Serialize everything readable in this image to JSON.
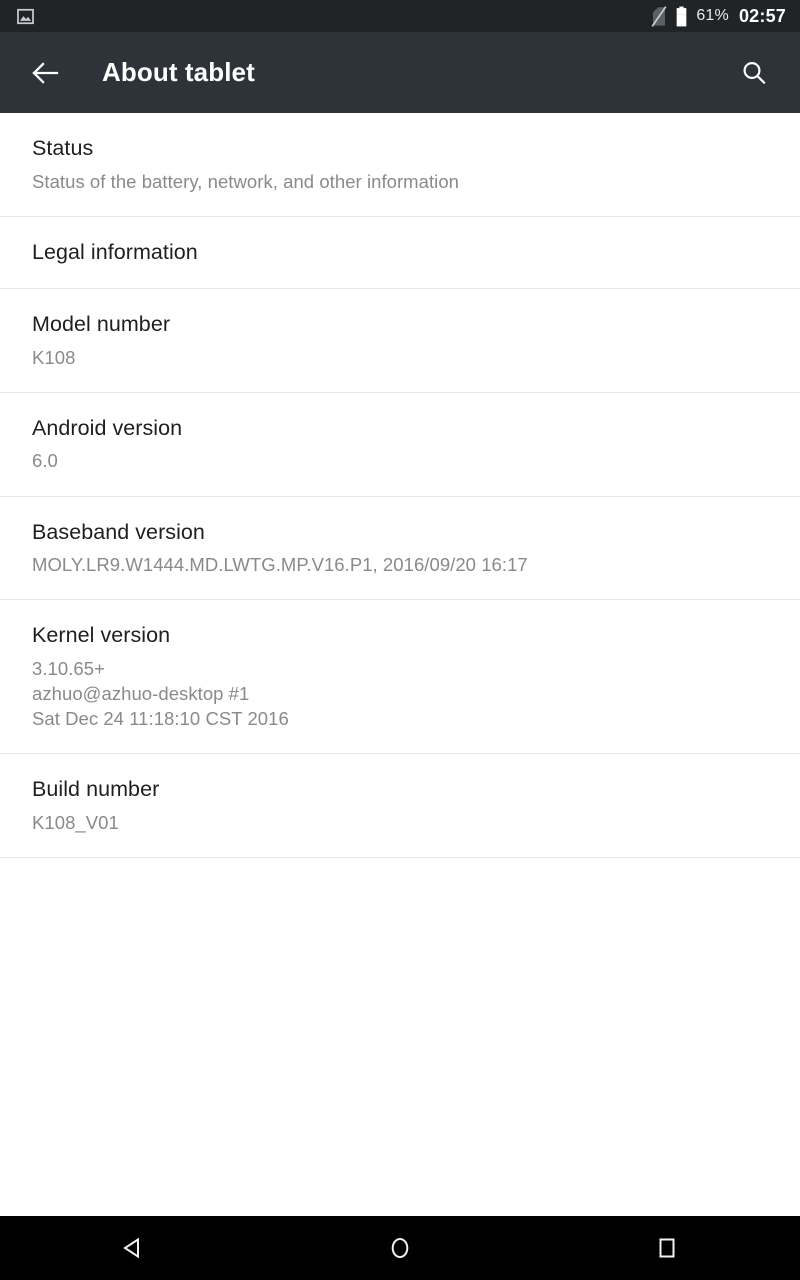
{
  "status_bar": {
    "notification_icon": "image-screenshot-icon",
    "sim_icon": "sim-card-off-icon",
    "battery_icon": "battery-icon",
    "battery_percent": "61%",
    "clock": "02:57",
    "background_color": "#212427"
  },
  "app_bar": {
    "back_icon": "arrow-back-icon",
    "title": "About tablet",
    "search_icon": "search-icon",
    "background_color": "#2d3339"
  },
  "settings": {
    "rows": [
      {
        "title": "Status",
        "summary": "Status of the battery, network, and other information",
        "summary_lines": []
      },
      {
        "title": "Legal information",
        "summary": "",
        "summary_lines": []
      },
      {
        "title": "Model number",
        "summary": "K108",
        "summary_lines": []
      },
      {
        "title": "Android version",
        "summary": "6.0",
        "summary_lines": []
      },
      {
        "title": "Baseband version",
        "summary": "MOLY.LR9.W1444.MD.LWTG.MP.V16.P1, 2016/09/20 16:17",
        "summary_lines": []
      },
      {
        "title": "Kernel version",
        "summary": "",
        "summary_lines": [
          "3.10.65+",
          "azhuo@azhuo-desktop #1",
          "Sat Dec 24 11:18:10 CST 2016"
        ]
      },
      {
        "title": "Build number",
        "summary": "K108_V01",
        "summary_lines": []
      }
    ]
  },
  "nav_bar": {
    "back_label": "back-button",
    "home_label": "home-button",
    "recents_label": "recents-button",
    "background_color": "#000000"
  }
}
